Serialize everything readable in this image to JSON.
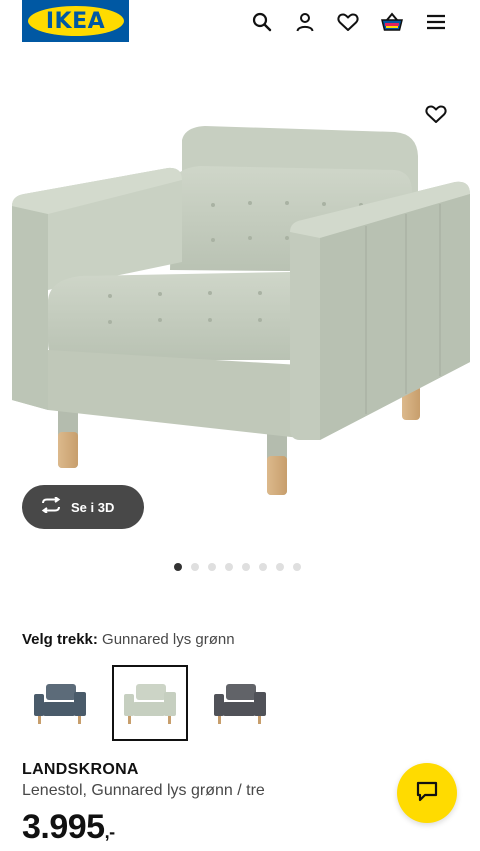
{
  "header": {
    "logo_text": "IKEA",
    "icons": [
      "search-icon",
      "user-icon",
      "heart-icon",
      "basket-icon",
      "menu-icon"
    ]
  },
  "gallery": {
    "view3d_label": "Se i 3D",
    "dot_count": 8,
    "active_dot": 1
  },
  "variant": {
    "label": "Velg trekk:",
    "value": "Gunnared lys grønn",
    "options": [
      {
        "color": "#4a5b6a",
        "selected": false
      },
      {
        "color": "#c6cfc0",
        "selected": true
      },
      {
        "color": "#505258",
        "selected": false
      }
    ]
  },
  "product": {
    "name": "LANDSKRONA",
    "description": "Lenestol, Gunnared lys grønn / tre",
    "price": "3.995",
    "price_suffix": ",-"
  },
  "colors": {
    "brand_blue": "#0058a3",
    "brand_yellow": "#ffdb00",
    "fabric": "#c3cbbd"
  }
}
